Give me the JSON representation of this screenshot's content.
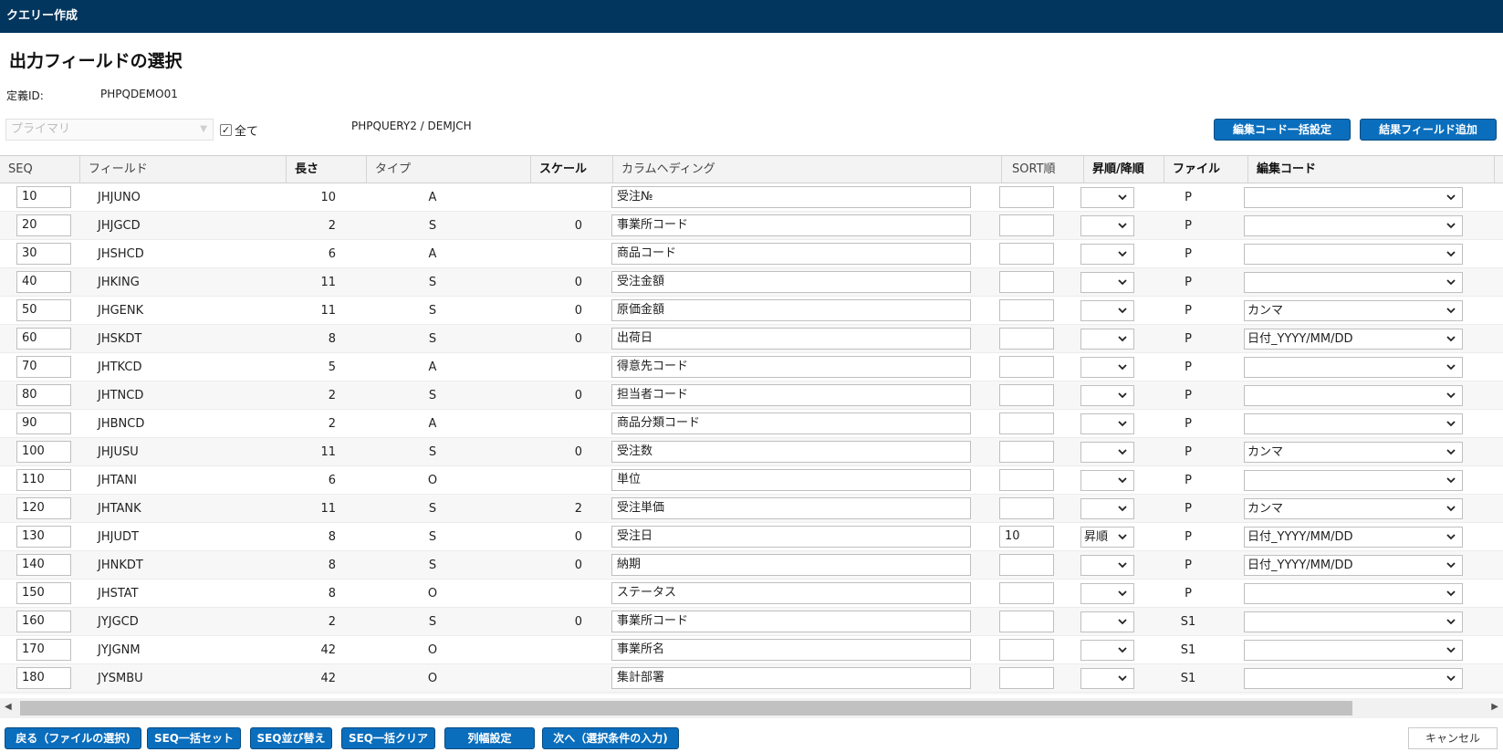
{
  "window": {
    "title": "クエリー作成"
  },
  "page": {
    "title": "出力フィールドの選択",
    "definition_label": "定義ID:",
    "definition_value": "PHPQDEMO01",
    "primary_select": "プライマリ",
    "all_label": "全て",
    "library_path": "PHPQUERY2 / DEMJCH"
  },
  "toolbar": {
    "bulk_edit_code": "編集コード一括設定",
    "add_result_field": "結果フィールド追加"
  },
  "columns": {
    "seq": "SEQ",
    "field": "フィールド",
    "length": "長さ",
    "type": "タイプ",
    "scale": "スケール",
    "heading": "カラムヘディング",
    "sort": "SORT順",
    "order": "昇順/降順",
    "file": "ファイル",
    "edit_code": "編集コード"
  },
  "rows": [
    {
      "seq": "10",
      "field": "JHJUNO",
      "length": "10",
      "type": "A",
      "scale": "",
      "heading": "受注№",
      "sort": "",
      "order": "",
      "file": "P",
      "edit": ""
    },
    {
      "seq": "20",
      "field": "JHJGCD",
      "length": "2",
      "type": "S",
      "scale": "0",
      "heading": "事業所コード",
      "sort": "",
      "order": "",
      "file": "P",
      "edit": ""
    },
    {
      "seq": "30",
      "field": "JHSHCD",
      "length": "6",
      "type": "A",
      "scale": "",
      "heading": "商品コード",
      "sort": "",
      "order": "",
      "file": "P",
      "edit": ""
    },
    {
      "seq": "40",
      "field": "JHKING",
      "length": "11",
      "type": "S",
      "scale": "0",
      "heading": "受注金額",
      "sort": "",
      "order": "",
      "file": "P",
      "edit": ""
    },
    {
      "seq": "50",
      "field": "JHGENK",
      "length": "11",
      "type": "S",
      "scale": "0",
      "heading": "原価金額",
      "sort": "",
      "order": "",
      "file": "P",
      "edit": "カンマ"
    },
    {
      "seq": "60",
      "field": "JHSKDT",
      "length": "8",
      "type": "S",
      "scale": "0",
      "heading": "出荷日",
      "sort": "",
      "order": "",
      "file": "P",
      "edit": "日付_YYYY/MM/DD"
    },
    {
      "seq": "70",
      "field": "JHTKCD",
      "length": "5",
      "type": "A",
      "scale": "",
      "heading": "得意先コード",
      "sort": "",
      "order": "",
      "file": "P",
      "edit": ""
    },
    {
      "seq": "80",
      "field": "JHTNCD",
      "length": "2",
      "type": "S",
      "scale": "0",
      "heading": "担当者コード",
      "sort": "",
      "order": "",
      "file": "P",
      "edit": ""
    },
    {
      "seq": "90",
      "field": "JHBNCD",
      "length": "2",
      "type": "A",
      "scale": "",
      "heading": "商品分類コード",
      "sort": "",
      "order": "",
      "file": "P",
      "edit": ""
    },
    {
      "seq": "100",
      "field": "JHJUSU",
      "length": "11",
      "type": "S",
      "scale": "0",
      "heading": "受注数",
      "sort": "",
      "order": "",
      "file": "P",
      "edit": "カンマ"
    },
    {
      "seq": "110",
      "field": "JHTANI",
      "length": "6",
      "type": "O",
      "scale": "",
      "heading": "単位",
      "sort": "",
      "order": "",
      "file": "P",
      "edit": ""
    },
    {
      "seq": "120",
      "field": "JHTANK",
      "length": "11",
      "type": "S",
      "scale": "2",
      "heading": "受注単価",
      "sort": "",
      "order": "",
      "file": "P",
      "edit": "カンマ"
    },
    {
      "seq": "130",
      "field": "JHJUDT",
      "length": "8",
      "type": "S",
      "scale": "0",
      "heading": "受注日",
      "sort": "10",
      "order": "昇順",
      "file": "P",
      "edit": "日付_YYYY/MM/DD"
    },
    {
      "seq": "140",
      "field": "JHNKDT",
      "length": "8",
      "type": "S",
      "scale": "0",
      "heading": "納期",
      "sort": "",
      "order": "",
      "file": "P",
      "edit": "日付_YYYY/MM/DD"
    },
    {
      "seq": "150",
      "field": "JHSTAT",
      "length": "8",
      "type": "O",
      "scale": "",
      "heading": "ステータス",
      "sort": "",
      "order": "",
      "file": "P",
      "edit": ""
    },
    {
      "seq": "160",
      "field": "JYJGCD",
      "length": "2",
      "type": "S",
      "scale": "0",
      "heading": "事業所コード",
      "sort": "",
      "order": "",
      "file": "S1",
      "edit": ""
    },
    {
      "seq": "170",
      "field": "JYJGNM",
      "length": "42",
      "type": "O",
      "scale": "",
      "heading": "事業所名",
      "sort": "",
      "order": "",
      "file": "S1",
      "edit": ""
    },
    {
      "seq": "180",
      "field": "JYSMBU",
      "length": "42",
      "type": "O",
      "scale": "",
      "heading": "集計部署",
      "sort": "",
      "order": "",
      "file": "S1",
      "edit": ""
    }
  ],
  "footer": {
    "back": "戻る（ファイルの選択)",
    "seq_set": "SEQ一括セット",
    "seq_sort": "SEQ並び替え",
    "seq_clear": "SEQ一括クリア",
    "col_width": "列幅設定",
    "next": "次へ（選択条件の入力)",
    "cancel": "キャンセル"
  }
}
